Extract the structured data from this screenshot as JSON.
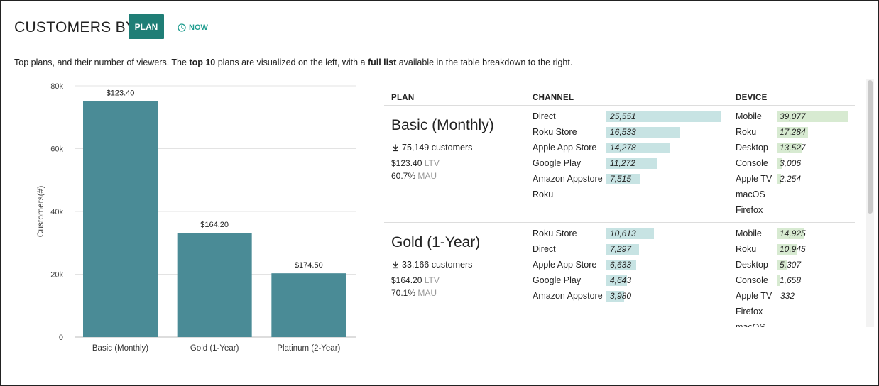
{
  "header": {
    "title": "CUSTOMERS BY",
    "plan_button": "PLAN",
    "now_button": "NOW"
  },
  "description": {
    "part1": "Top plans, and their number of viewers. The ",
    "bold1": "top 10",
    "part2": " plans are visualized on the left, with a ",
    "bold2": "full list",
    "part3": " available in the table breakdown to the right."
  },
  "chart_data": {
    "type": "bar",
    "categories": [
      "Basic (Monthly)",
      "Gold (1-Year)",
      "Platinum (2-Year)"
    ],
    "values": [
      75149,
      33166,
      20300
    ],
    "data_labels": [
      "$123.40",
      "$164.20",
      "$174.50"
    ],
    "ylabel": "Customers(#)",
    "ylim": [
      0,
      80000
    ],
    "y_ticks": [
      0,
      20000,
      40000,
      60000,
      80000
    ],
    "y_tick_labels": [
      "0",
      "20k",
      "40k",
      "60k",
      "80k"
    ],
    "grid": true,
    "color": "#4a8b96"
  },
  "table": {
    "headers": {
      "plan": "PLAN",
      "channel": "CHANNEL",
      "device": "DEVICE"
    },
    "channel_max": 25551,
    "device_max": 39077,
    "groups": [
      {
        "name": "Basic (Monthly)",
        "customers": "75,149 customers",
        "ltv_value": "$123.40",
        "ltv_label": "LTV",
        "mau_value": "60.7%",
        "mau_label": "MAU",
        "channels": [
          {
            "label": "Direct",
            "value": 25551,
            "display": "25,551"
          },
          {
            "label": "Roku Store",
            "value": 16533,
            "display": "16,533"
          },
          {
            "label": "Apple App Store",
            "value": 14278,
            "display": "14,278"
          },
          {
            "label": "Google Play",
            "value": 11272,
            "display": "11,272"
          },
          {
            "label": "Amazon Appstore",
            "value": 7515,
            "display": "7,515"
          },
          {
            "label": "Roku",
            "value": null,
            "display": ""
          }
        ],
        "devices": [
          {
            "label": "Mobile",
            "value": 39077,
            "display": "39,077"
          },
          {
            "label": "Roku",
            "value": 17284,
            "display": "17,284"
          },
          {
            "label": "Desktop",
            "value": 13527,
            "display": "13,527"
          },
          {
            "label": "Console",
            "value": 3006,
            "display": "3,006"
          },
          {
            "label": "Apple TV",
            "value": 2254,
            "display": "2,254"
          },
          {
            "label": "macOS",
            "value": null,
            "display": ""
          },
          {
            "label": "Firefox",
            "value": null,
            "display": ""
          }
        ]
      },
      {
        "name": "Gold (1-Year)",
        "customers": "33,166 customers",
        "ltv_value": "$164.20",
        "ltv_label": "LTV",
        "mau_value": "70.1%",
        "mau_label": "MAU",
        "channels": [
          {
            "label": "Roku Store",
            "value": 10613,
            "display": "10,613"
          },
          {
            "label": "Direct",
            "value": 7297,
            "display": "7,297"
          },
          {
            "label": "Apple App Store",
            "value": 6633,
            "display": "6,633"
          },
          {
            "label": "Google Play",
            "value": 4643,
            "display": "4,643"
          },
          {
            "label": "Amazon Appstore",
            "value": 3980,
            "display": "3,980"
          }
        ],
        "devices": [
          {
            "label": "Mobile",
            "value": 14925,
            "display": "14,925"
          },
          {
            "label": "Roku",
            "value": 10945,
            "display": "10,945"
          },
          {
            "label": "Desktop",
            "value": 5307,
            "display": "5,307"
          },
          {
            "label": "Console",
            "value": 1658,
            "display": "1,658"
          },
          {
            "label": "Apple TV",
            "value": 332,
            "display": "332"
          },
          {
            "label": "Firefox",
            "value": null,
            "display": ""
          },
          {
            "label": "macOS",
            "value": null,
            "display": ""
          }
        ]
      }
    ]
  }
}
